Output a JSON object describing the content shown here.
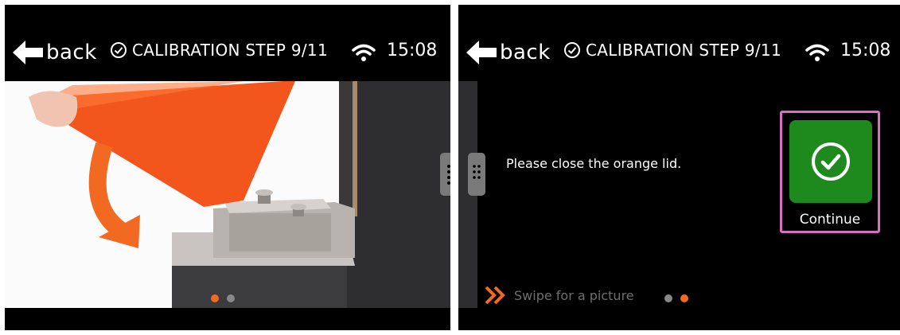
{
  "left_screen": {
    "header": {
      "back_label": "back",
      "step_label": "CALIBRATION STEP 9/11",
      "time": "15:08"
    },
    "pager": {
      "active_index": 0,
      "count": 2
    },
    "illustration": {
      "subject": "hand closing orange lid onto printer"
    }
  },
  "right_screen": {
    "header": {
      "back_label": "back",
      "step_label": "CALIBRATION STEP 9/11",
      "time": "15:08"
    },
    "message": "Please close the orange lid.",
    "continue_label": "Continue",
    "swipe_hint": "Swipe for a picture",
    "pager": {
      "active_index": 1,
      "count": 2
    }
  },
  "colors": {
    "accent": "#f26a21",
    "continue": "#1e8a1e",
    "highlight": "#d86fc2",
    "background": "#000000"
  },
  "icons": [
    "back-arrow-icon",
    "check-circle-icon",
    "wifi-icon",
    "handle-dots-icon",
    "double-chevron-right-icon",
    "checkmark-icon"
  ]
}
